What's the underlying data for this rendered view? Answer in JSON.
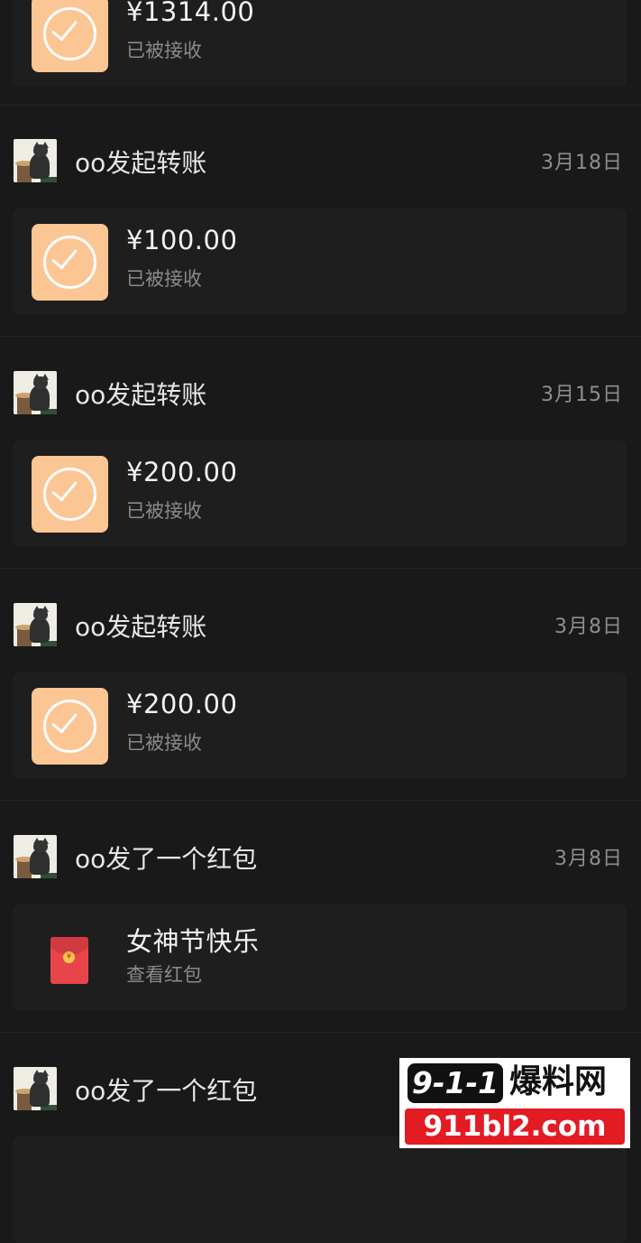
{
  "items": [
    {
      "kind": "transfer",
      "amount": "¥1314.00",
      "status": "已被接收"
    },
    {
      "kind": "transfer",
      "sender": "oo发起转账",
      "date": "3月18日",
      "amount": "¥100.00",
      "status": "已被接收"
    },
    {
      "kind": "transfer",
      "sender": "oo发起转账",
      "date": "3月15日",
      "amount": "¥200.00",
      "status": "已被接收"
    },
    {
      "kind": "transfer",
      "sender": "oo发起转账",
      "date": "3月8日",
      "amount": "¥200.00",
      "status": "已被接收"
    },
    {
      "kind": "red_packet",
      "sender": "oo发了一个红包",
      "date": "3月8日",
      "greeting": "女神节快乐",
      "action": "查看红包"
    },
    {
      "kind": "red_packet",
      "sender": "oo发了一个红包"
    }
  ],
  "icons": {
    "transfer": "check-circle-icon",
    "red_packet": "red-envelope-icon",
    "avatar": "cat-avatar"
  },
  "colors": {
    "background": "#191919",
    "card": "#1e1e1e",
    "transfer_icon": "#fbc594",
    "red_packet": "#e8454a",
    "watermark_red": "#e31b23"
  },
  "watermark": {
    "logo": "9-1-1",
    "text": "爆料网",
    "url": "911bl2.com"
  }
}
